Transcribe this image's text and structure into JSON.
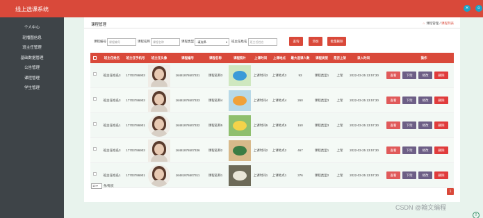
{
  "app": {
    "title": "线上选课系统"
  },
  "topbar": {
    "icon1": "settings-icon",
    "icon2": "user-icon",
    "icon1_glyph": "✕",
    "icon2_glyph": "☺"
  },
  "sidebar": {
    "items": [
      "个人中心",
      "轮播图信息",
      "班主任管理",
      "基础数据管理",
      "公告管理",
      "课程管理",
      "学生管理"
    ]
  },
  "breadcrumb": {
    "title": "课程管理",
    "home_glyph": "⌂",
    "path": [
      "课程管理",
      "课程列表"
    ],
    "separator": "/"
  },
  "filters": {
    "labels": [
      "课程编号",
      "课程名称",
      "课程类型",
      "班主任姓名"
    ],
    "placeholders": [
      "课程编号",
      "课程名称",
      "班主任姓名"
    ],
    "select_value": "-请选择-",
    "buttons": [
      "查询",
      "添加",
      "批量删除"
    ]
  },
  "table": {
    "headers": [
      "班主任姓名",
      "班主任手机号",
      "班主任头像",
      "课程编号",
      "课程名称",
      "课程照片",
      "上课时间",
      "上课地点",
      "最大选课人数",
      "课程类型",
      "是否上架",
      "录入时间",
      "操作"
    ],
    "rows": [
      {
        "teacher": "班主任姓名3",
        "phone": "17703786903",
        "code": "164818765073​31",
        "course": "课程名称3",
        "time": "上课时间3",
        "place": "上课地点3",
        "max": "93",
        "type": "课程类型1",
        "status": "上架",
        "created": "2022-03-25 13:57:30"
      },
      {
        "teacher": "班主任姓名3",
        "phone": "17703786903",
        "code": "16481876507333",
        "course": "课程名称4",
        "time": "上课时间4",
        "place": "上课地点4",
        "max": "260",
        "type": "课程类型3",
        "status": "上架",
        "created": "2022-03-25 13:57:30"
      },
      {
        "teacher": "班主任姓名1",
        "phone": "17703786901",
        "code": "16481876507332",
        "course": "课程名称5",
        "time": "上课时间5",
        "place": "上课地点5",
        "max": "150",
        "type": "课程类型3",
        "status": "上架",
        "created": "2022-03-25 13:57:30"
      },
      {
        "teacher": "班主任姓名3",
        "phone": "17703786903",
        "code": "16481876507336",
        "course": "课程名称2",
        "time": "上课时间2",
        "place": "上课地点2",
        "max": "467",
        "type": "课程类型1",
        "status": "上架",
        "created": "2022-03-25 13:57:30"
      },
      {
        "teacher": "班主任姓名1",
        "phone": "17703786901",
        "code": "16481876507311",
        "course": "课程名称1",
        "time": "上课时间1",
        "place": "上课地点1",
        "max": "376",
        "type": "课程类型2",
        "status": "上架",
        "created": "2022-03-25 13:57:30"
      }
    ],
    "actions": [
      "查看",
      "下架",
      "修改",
      "删除"
    ]
  },
  "pager": {
    "page_size": "10",
    "page_size_suffix": "条/每页",
    "current_page": "1"
  },
  "watermark": "CSDN @翰文编程",
  "colors": {
    "primary": "#d9493a",
    "sidebar": "#3e4448",
    "view": "#e05a5a",
    "offshelf": "#6d5f86",
    "edit": "#6d5f86",
    "delete": "#e03c3c"
  }
}
